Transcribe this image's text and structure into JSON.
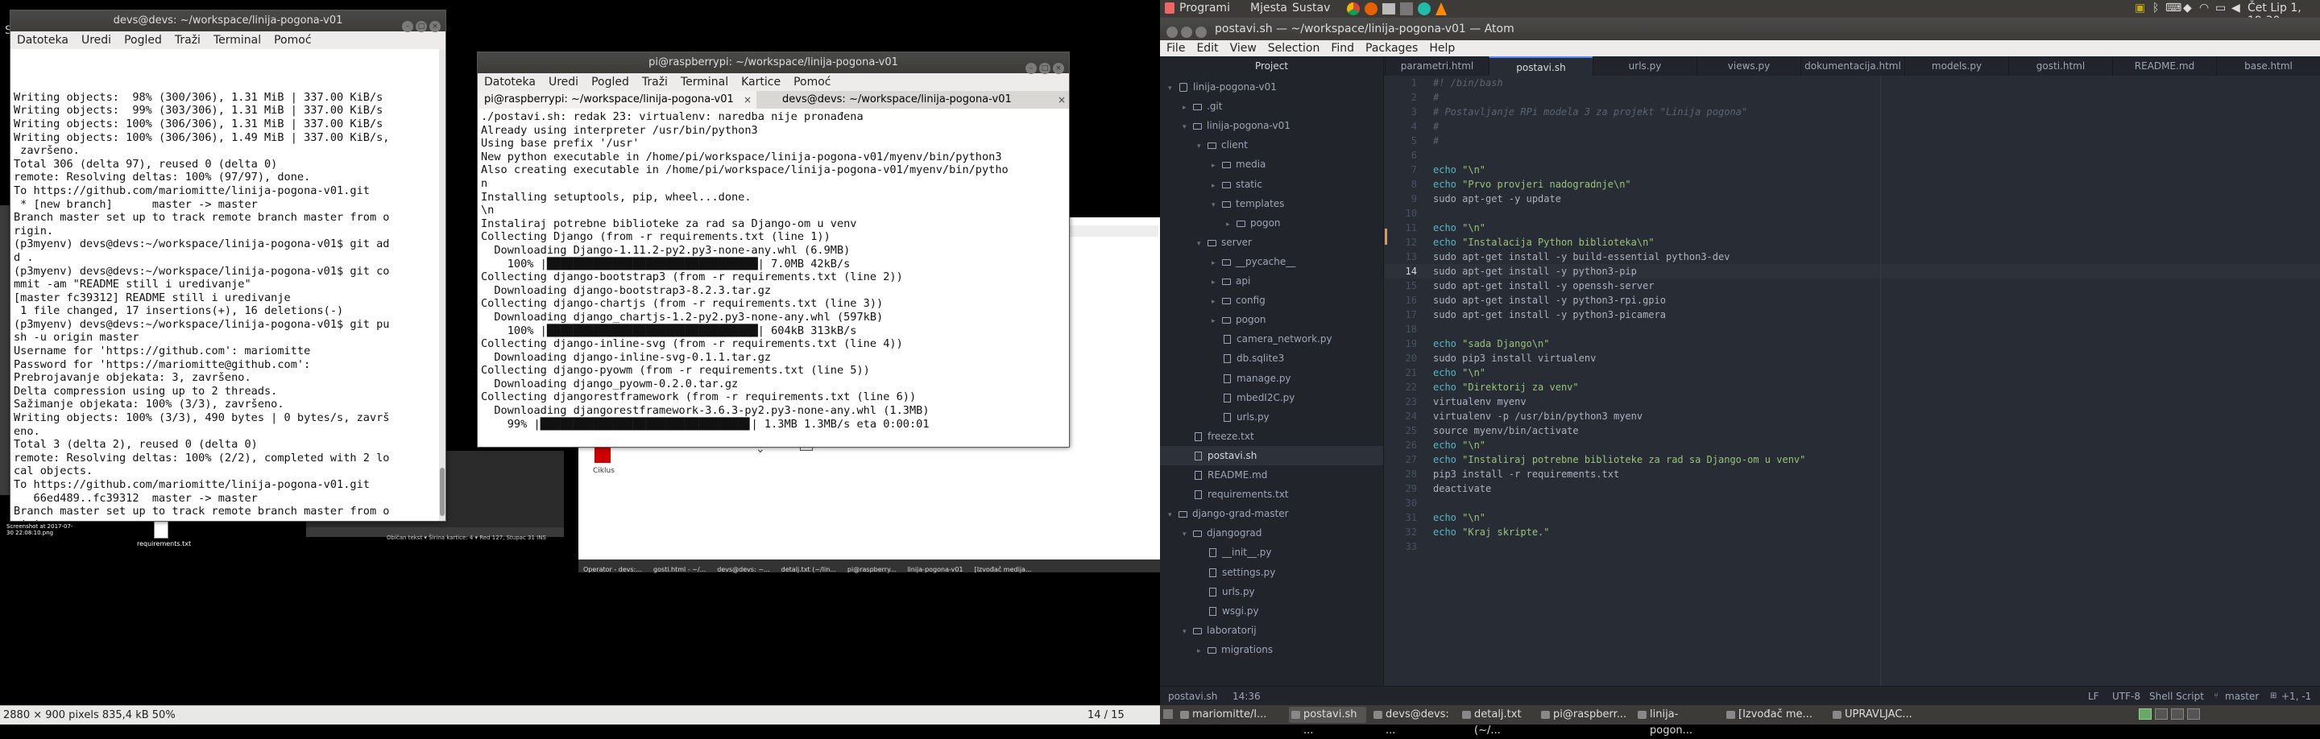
{
  "viewer": {
    "title": "Slik",
    "status_left": "2880 × 900 pixels  835,4 kB   50%",
    "status_page": "14 / 15"
  },
  "bg": {
    "taskbar_items": [
      "Operator - devs:...",
      "gosti.html - ~/...",
      "devs@devs: ~...",
      "detalj.txt (~/lin...",
      "pi@raspberry...",
      "linija-pogona-v01",
      "[Izvođač medija..."
    ],
    "status_strip": "Običan tekst ▾   Širina kartice: 4 ▾   Red 127, Stupac 31   INS",
    "desk_file": "requirements.txt",
    "desk_shot": "Screenshot at 2017-07-30 22:08:10.png",
    "tile": "Ciklus"
  },
  "term1": {
    "title": "devs@devs: ~/workspace/linija-pogona-v01",
    "menu": [
      "Datoteka",
      "Uredi",
      "Pogled",
      "Traži",
      "Terminal",
      "Pomoć"
    ],
    "lines": [
      "Writing objects:  98% (300/306), 1.31 MiB | 337.00 KiB/s",
      "Writing objects:  99% (303/306), 1.31 MiB | 337.00 KiB/s",
      "Writing objects: 100% (306/306), 1.31 MiB | 337.00 KiB/s",
      "Writing objects: 100% (306/306), 1.49 MiB | 337.00 KiB/s,",
      " završeno.",
      "Total 306 (delta 97), reused 0 (delta 0)",
      "remote: Resolving deltas: 100% (97/97), done.",
      "To https://github.com/mariomitte/linija-pogona-v01.git",
      " * [new branch]      master -> master",
      "Branch master set up to track remote branch master from o",
      "rigin.",
      "(p3myenv) devs@devs:~/workspace/linija-pogona-v01$ git ad",
      "d .",
      "(p3myenv) devs@devs:~/workspace/linija-pogona-v01$ git co",
      "mmit -am \"README still i uredivanje\"",
      "[master fc39312] README still i uredivanje",
      " 1 file changed, 17 insertions(+), 16 deletions(-)",
      "(p3myenv) devs@devs:~/workspace/linija-pogona-v01$ git pu",
      "sh -u origin master",
      "Username for 'https://github.com': mariomitte",
      "Password for 'https://mariomitte@github.com':",
      "Prebrojavanje objekata: 3, završeno.",
      "Delta compression using up to 2 threads.",
      "Sažimanje objekata: 100% (3/3), završeno.",
      "Writing objects: 100% (3/3), 490 bytes | 0 bytes/s, završ",
      "eno.",
      "Total 3 (delta 2), reused 0 (delta 0)",
      "remote: Resolving deltas: 100% (2/2), completed with 2 lo",
      "cal objects.",
      "To https://github.com/mariomitte/linija-pogona-v01.git",
      "   66ed489..fc39312  master -> master",
      "Branch master set up to track remote branch master from o",
      "rigin.",
      "(p3myenv) devs@devs:~/workspace/linija-pogona-v01$ "
    ]
  },
  "term2": {
    "title": "pi@raspberrypi: ~/workspace/linija-pogona-v01",
    "menu": [
      "Datoteka",
      "Uredi",
      "Pogled",
      "Traži",
      "Terminal",
      "Kartice",
      "Pomoć"
    ],
    "tab1": "pi@raspberrypi: ~/workspace/linija-pogona-v01",
    "tab2": "devs@devs: ~/workspace/linija-pogona-v01",
    "lines": [
      "./postavi.sh: redak 23: virtualenv: naredba nije pronađena",
      "Already using interpreter /usr/bin/python3",
      "Using base prefix '/usr'",
      "New python executable in /home/pi/workspace/linija-pogona-v01/myenv/bin/python3",
      "Also creating executable in /home/pi/workspace/linija-pogona-v01/myenv/bin/pytho",
      "n",
      "Installing setuptools, pip, wheel...done.",
      "\\n",
      "Instaliraj potrebne biblioteke za rad sa Django-om u venv",
      "Collecting Django (from -r requirements.txt (line 1))",
      "  Downloading Django-1.11.2-py2.py3-none-any.whl (6.9MB)",
      "    100% |████████████████████████████████| 7.0MB 42kB/s",
      "Collecting django-bootstrap3 (from -r requirements.txt (line 2))",
      "  Downloading django-bootstrap3-8.2.3.tar.gz",
      "Collecting django-chartjs (from -r requirements.txt (line 3))",
      "  Downloading django_chartjs-1.2-py2.py3-none-any.whl (597kB)",
      "    100% |████████████████████████████████| 604kB 313kB/s",
      "Collecting django-inline-svg (from -r requirements.txt (line 4))",
      "  Downloading django-inline-svg-0.1.1.tar.gz",
      "Collecting django-pyowm (from -r requirements.txt (line 5))",
      "  Downloading django_pyowm-0.2.0.tar.gz",
      "Collecting djangorestframework (from -r requirements.txt (line 6))",
      "  Downloading djangorestframework-3.6.3-py2.py3-none-any.whl (1.3MB)",
      "    99% |███████████████████████████████▊| 1.3MB 1.3MB/s eta 0:00:01"
    ]
  },
  "top_panel": {
    "menu": [
      "Programi",
      "Mjesta",
      "Sustav"
    ],
    "clock": "Čet Lip  1, 19:30"
  },
  "atom": {
    "title": "postavi.sh — ~/workspace/linija-pogona-v01 — Atom",
    "menu": [
      "File",
      "Edit",
      "View",
      "Selection",
      "Find",
      "Packages",
      "Help"
    ],
    "tree_header": "Project",
    "tabs": [
      "parametri.html",
      "postavi.sh",
      "urls.py",
      "views.py",
      "dokumentacija.html",
      "models.py",
      "gosti.html",
      "README.md",
      "base.html"
    ],
    "tree": [
      {
        "label": "linija-pogona-v01",
        "icon": "repo",
        "chev": "▾"
      },
      {
        "label": ".git",
        "icon": "folder",
        "chev": "▸"
      },
      {
        "label": "linija-pogona-v01",
        "icon": "folder",
        "chev": "▾"
      },
      {
        "label": "client",
        "icon": "folder",
        "chev": "▾"
      },
      {
        "label": "media",
        "icon": "folder",
        "chev": "▸"
      },
      {
        "label": "static",
        "icon": "folder",
        "chev": "▸"
      },
      {
        "label": "templates",
        "icon": "folder",
        "chev": "▾"
      },
      {
        "label": "pogon",
        "icon": "folder",
        "chev": "▸"
      },
      {
        "label": "server",
        "icon": "folder",
        "chev": "▾"
      },
      {
        "label": "__pycache__",
        "icon": "folder",
        "chev": "▸"
      },
      {
        "label": "api",
        "icon": "folder",
        "chev": "▸"
      },
      {
        "label": "config",
        "icon": "folder",
        "chev": "▸"
      },
      {
        "label": "pogon",
        "icon": "folder",
        "chev": "▸"
      },
      {
        "label": "camera_network.py",
        "icon": "file",
        "chev": ""
      },
      {
        "label": "db.sqlite3",
        "icon": "file",
        "chev": ""
      },
      {
        "label": "manage.py",
        "icon": "file",
        "chev": ""
      },
      {
        "label": "mbedI2C.py",
        "icon": "file",
        "chev": ""
      },
      {
        "label": "urls.py",
        "icon": "file",
        "chev": ""
      },
      {
        "label": "freeze.txt",
        "icon": "file",
        "chev": ""
      },
      {
        "label": "postavi.sh",
        "icon": "file",
        "chev": ""
      },
      {
        "label": "README.md",
        "icon": "file",
        "chev": ""
      },
      {
        "label": "requirements.txt",
        "icon": "file",
        "chev": ""
      },
      {
        "label": "django-grad-master",
        "icon": "folder",
        "chev": "▾"
      },
      {
        "label": "djangograd",
        "icon": "folder",
        "chev": "▾"
      },
      {
        "label": "__init__.py",
        "icon": "file",
        "chev": ""
      },
      {
        "label": "settings.py",
        "icon": "file",
        "chev": ""
      },
      {
        "label": "urls.py",
        "icon": "file",
        "chev": ""
      },
      {
        "label": "wsgi.py",
        "icon": "file",
        "chev": ""
      },
      {
        "label": "laboratorij",
        "icon": "folder",
        "chev": "▾"
      },
      {
        "label": "migrations",
        "icon": "folder",
        "chev": "▸"
      }
    ],
    "code": [
      {
        "t": "#! /bin/bash",
        "c": "c"
      },
      {
        "t": "#",
        "c": "c"
      },
      {
        "t": "# Postavljanje RPi modela 3 za projekt \"Linija pogona\"",
        "c": "c"
      },
      {
        "t": "#",
        "c": "c"
      },
      {
        "t": "#",
        "c": "c"
      },
      {
        "t": "",
        "c": "p"
      },
      {
        "t": "echo \"\\n\"",
        "c": "e"
      },
      {
        "t": "echo \"Prvo provjeri nadogradnje\\n\"",
        "c": "e"
      },
      {
        "t": "sudo apt-get -y update",
        "c": "p"
      },
      {
        "t": "",
        "c": "p"
      },
      {
        "t": "echo \"\\n\"",
        "c": "e"
      },
      {
        "t": "echo \"Instalacija Python biblioteka\\n\"",
        "c": "e"
      },
      {
        "t": "sudo apt-get install -y build-essential python3-dev",
        "c": "p"
      },
      {
        "t": "sudo apt-get install -y python3-pip",
        "c": "p"
      },
      {
        "t": "sudo apt-get install -y openssh-server",
        "c": "p"
      },
      {
        "t": "sudo apt-get install -y python3-rpi.gpio",
        "c": "p"
      },
      {
        "t": "sudo apt-get install -y python3-picamera",
        "c": "p"
      },
      {
        "t": "",
        "c": "p"
      },
      {
        "t": "echo \"sada Django\\n\"",
        "c": "e"
      },
      {
        "t": "sudo pip3 install virtualenv",
        "c": "p"
      },
      {
        "t": "echo \"\\n\"",
        "c": "e"
      },
      {
        "t": "echo \"Direktorij za venv\"",
        "c": "e"
      },
      {
        "t": "virtualenv myenv",
        "c": "p"
      },
      {
        "t": "virtualenv -p /usr/bin/python3 myenv",
        "c": "p"
      },
      {
        "t": "source myenv/bin/activate",
        "c": "p"
      },
      {
        "t": "echo \"\\n\"",
        "c": "e"
      },
      {
        "t": "echo \"Instaliraj potrebne biblioteke za rad sa Django-om u venv\"",
        "c": "e"
      },
      {
        "t": "pip3 install -r requirements.txt",
        "c": "p"
      },
      {
        "t": "deactivate",
        "c": "p"
      },
      {
        "t": "",
        "c": "p"
      },
      {
        "t": "echo \"\\n\"",
        "c": "e"
      },
      {
        "t": "echo \"Kraj skripte.\"",
        "c": "e"
      },
      {
        "t": "",
        "c": "p"
      }
    ],
    "current_line": 14,
    "status": {
      "file": "postavi.sh",
      "pos": "14:36",
      "eol": "LF",
      "enc": "UTF-8",
      "grammar": "Shell Script",
      "branch": "master",
      "diff": "+1, -1"
    }
  },
  "taskbar": {
    "items": [
      "mariomitte/l...",
      "postavi.sh ...",
      "devs@devs: ...",
      "detalj.txt (~/...",
      "pi@raspberr...",
      "linija-pogon...",
      "[Izvođač me...",
      "UPRAVLJAC..."
    ]
  }
}
